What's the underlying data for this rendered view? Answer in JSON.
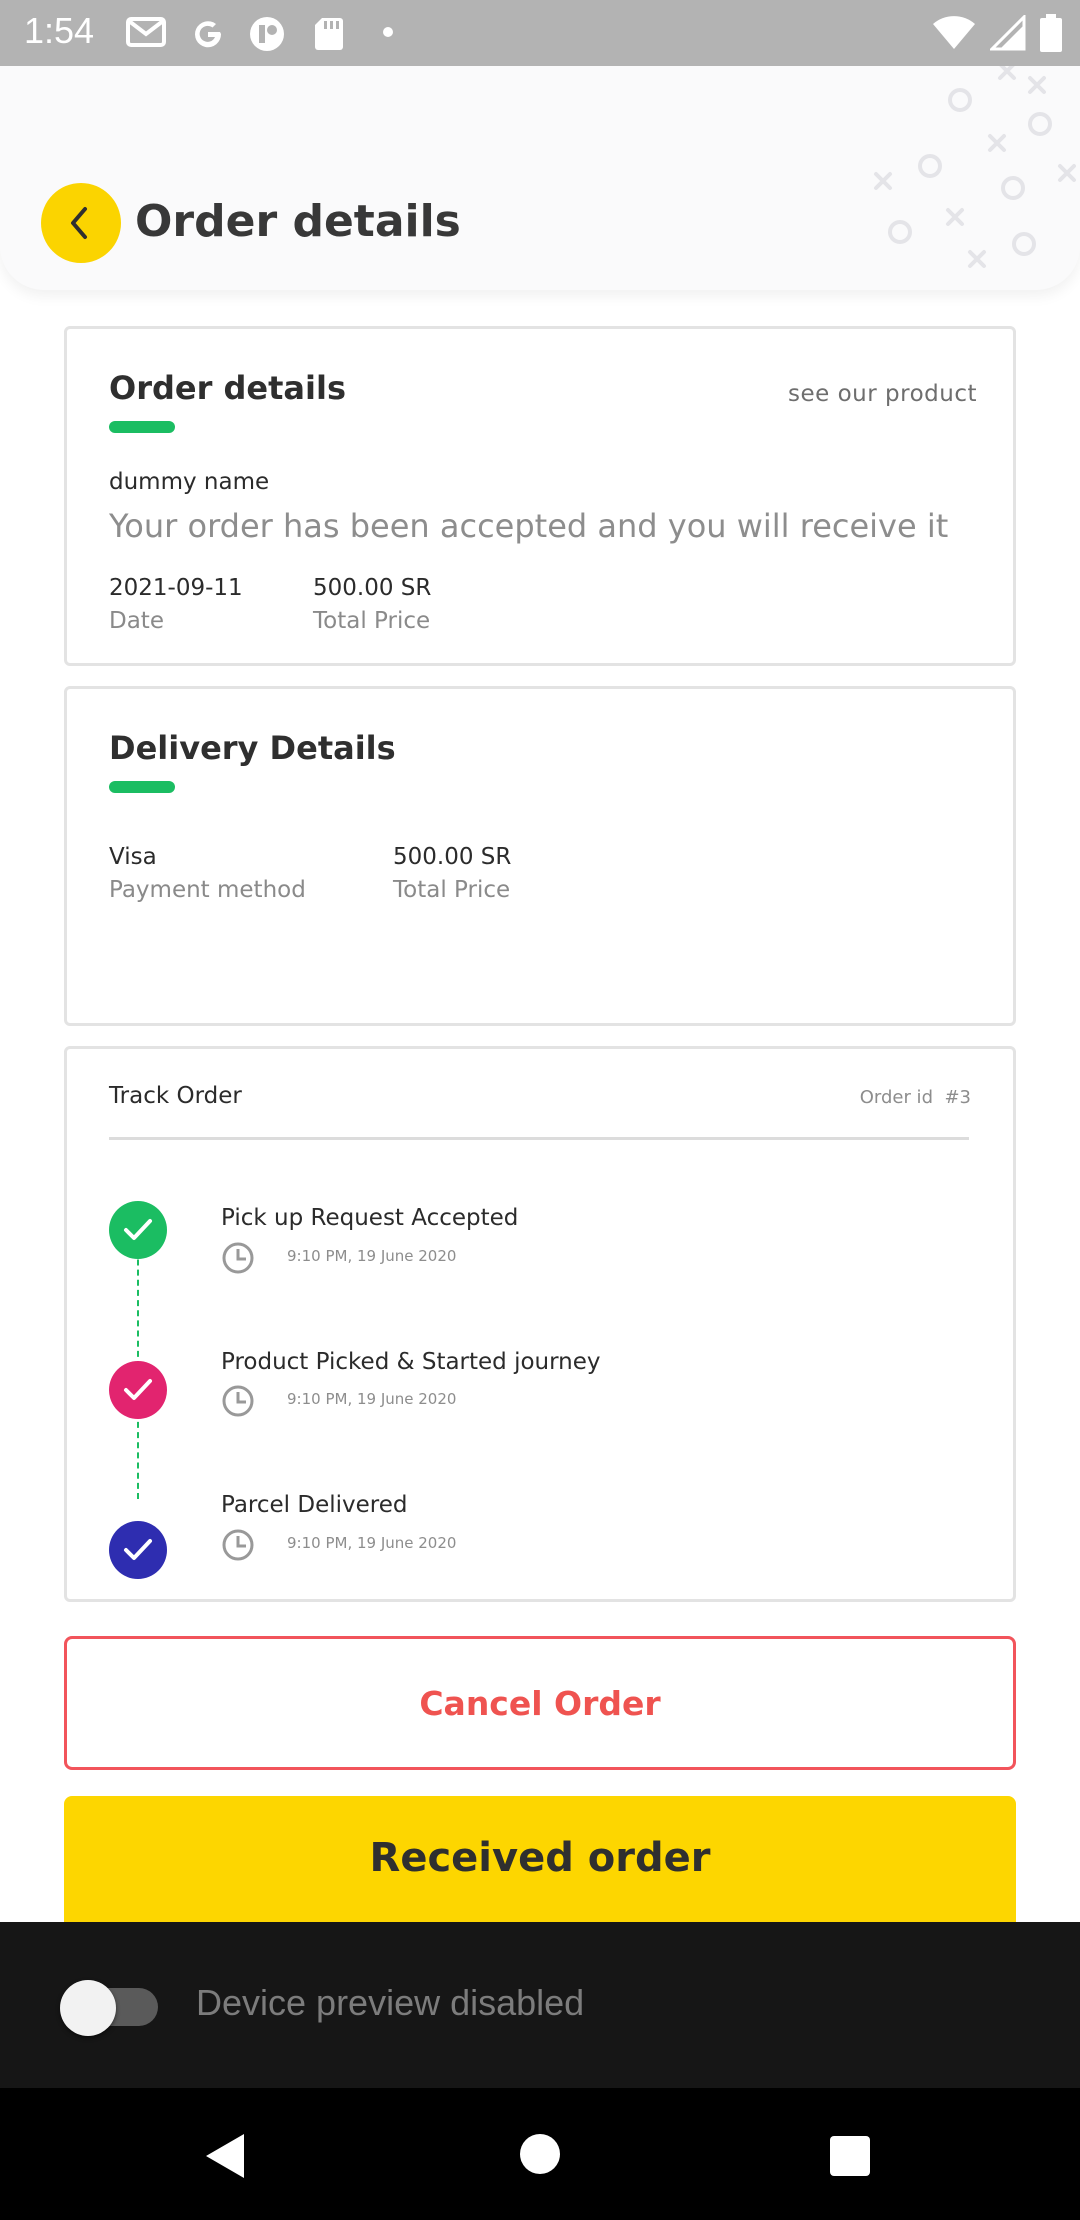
{
  "status_bar": {
    "time": "1:54",
    "left_icons": [
      "gmail-icon",
      "google-icon",
      "app-icon",
      "sd-card-icon",
      "dot-icon"
    ],
    "right_icons": [
      "wifi-icon",
      "signal-icon",
      "battery-icon"
    ]
  },
  "header": {
    "title": "Order details",
    "back_icon": "chevron-left-icon"
  },
  "order_card": {
    "title": "Order details",
    "see_product": "see our product",
    "name": "dummy name",
    "message": "Your order has been accepted and you will receive it",
    "date_value": "2021-09-11",
    "date_label": "Date",
    "price_value": "500.00 SR",
    "price_label": "Total Price"
  },
  "delivery_card": {
    "title": "Delivery Details",
    "payment_value": "Visa",
    "payment_label": "Payment method",
    "price_value": "500.00 SR",
    "price_label": "Total Price"
  },
  "track_card": {
    "title": "Track Order",
    "order_id_label": "Order id",
    "order_id_value": "#3",
    "steps": [
      {
        "title": "Pick up Request Accepted",
        "time": "9:10 PM, 19 June 2020",
        "color": "#1bbd62"
      },
      {
        "title": "Product Picked & Started journey",
        "time": "9:10 PM, 19 June 2020",
        "color": "#e2246f"
      },
      {
        "title": "Parcel Delivered",
        "time": "9:10 PM, 19 June 2020",
        "color": "#2e2db0"
      }
    ]
  },
  "actions": {
    "cancel_label": "Cancel Order",
    "received_label": "Received order"
  },
  "preview": {
    "label": "Device preview disabled",
    "toggle_on": false
  },
  "colors": {
    "accent_yellow": "#fdd600",
    "green": "#1bbd62",
    "cancel_red": "#ef5350"
  }
}
